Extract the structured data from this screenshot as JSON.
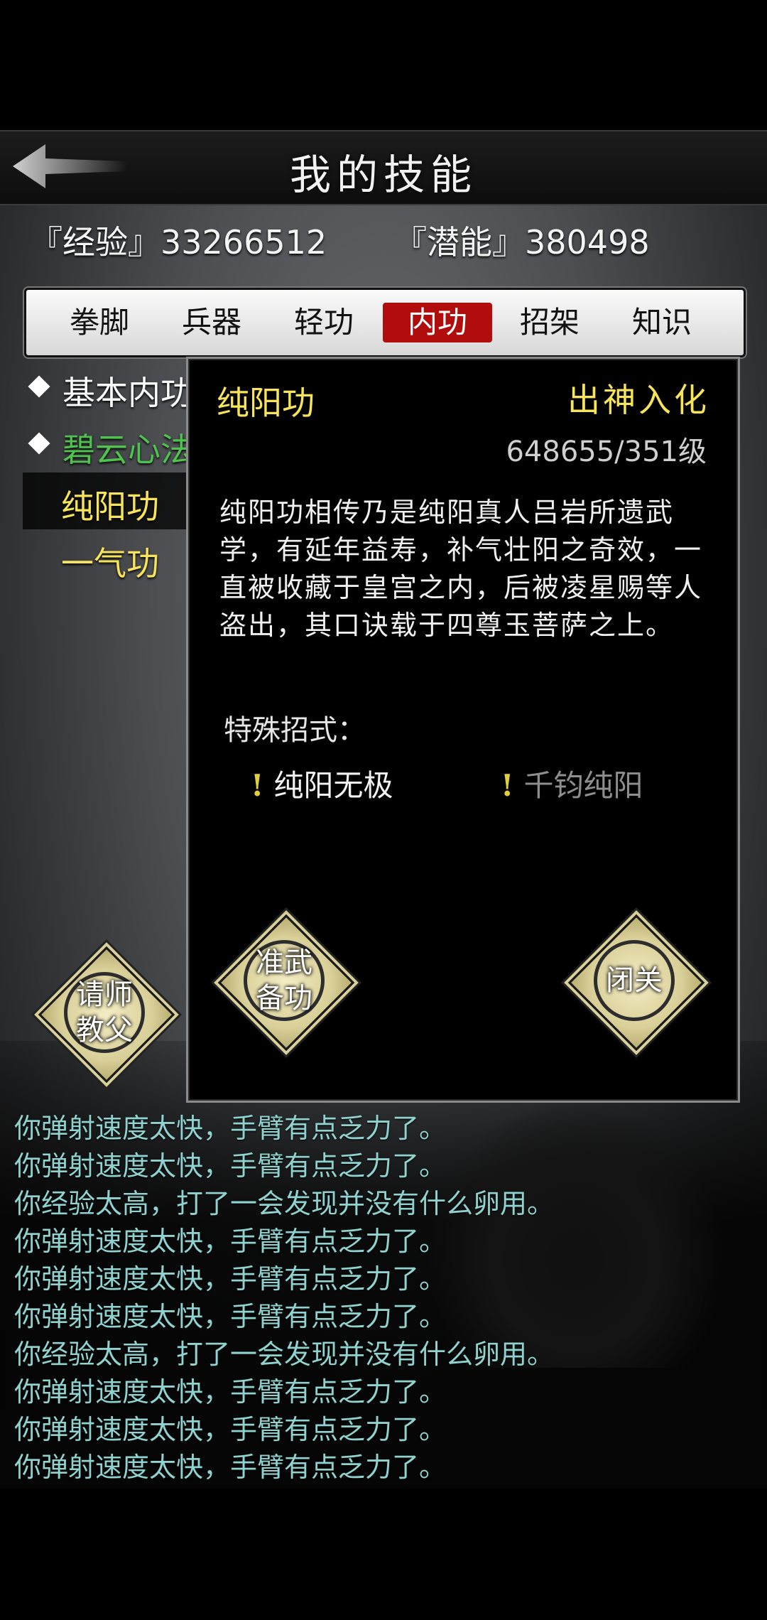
{
  "header": {
    "title": "我的技能"
  },
  "stats": {
    "exp_text": "『经验』33266512",
    "pot_text": "『潜能』380498"
  },
  "tabs": [
    {
      "label": "拳脚"
    },
    {
      "label": "兵器"
    },
    {
      "label": "轻功"
    },
    {
      "label": "内功"
    },
    {
      "label": "招架"
    },
    {
      "label": "知识"
    }
  ],
  "active_tab": "内功",
  "skills": [
    {
      "label": "基本内功",
      "color": "#ffffff"
    },
    {
      "label": "碧云心法",
      "color": "#4fc24f"
    },
    {
      "label": "纯阳功",
      "color": "#f7e45a"
    },
    {
      "label": "一气功",
      "color": "#f7e45a"
    }
  ],
  "detail": {
    "name": "纯阳功",
    "rank": "出神入化",
    "level": "648655/351级",
    "description": "纯阳功相传乃是纯阳真人吕岩所遗武学，有延年益寿，补气壮阳之奇效，一直被收藏于皇宫之内，后被凌星赐等人盗出，其口诀载于四尊玉菩萨之上。",
    "special_label": "特殊招式：",
    "moves": [
      {
        "bang": "!",
        "label": "纯阳无极"
      },
      {
        "bang": "!",
        "label": "千钧纯阳"
      }
    ],
    "btn_prepare_line1": "准武",
    "btn_prepare_line2": "备功",
    "btn_seclude": "闭关"
  },
  "side_button": {
    "line1": "请师",
    "line2": "教父"
  },
  "log": [
    "你弹射速度太快，手臂有点乏力了。",
    "你弹射速度太快，手臂有点乏力了。",
    "你经验太高，打了一会发现并没有什么卵用。",
    "你弹射速度太快，手臂有点乏力了。",
    "你弹射速度太快，手臂有点乏力了。",
    "你弹射速度太快，手臂有点乏力了。",
    "你经验太高，打了一会发现并没有什么卵用。",
    "你弹射速度太快，手臂有点乏力了。",
    "你弹射速度太快，手臂有点乏力了。",
    "你弹射速度太快，手臂有点乏力了。"
  ],
  "colors": {
    "active_tab": "#b20d0d",
    "gold": "#f7e45a",
    "log": "#8fd2cf"
  }
}
